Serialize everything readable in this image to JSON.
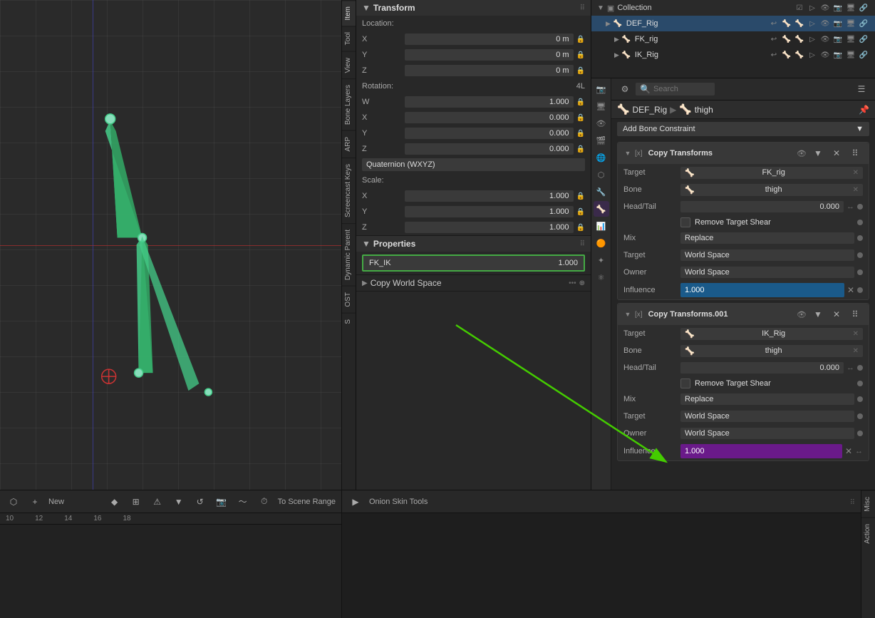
{
  "viewport": {
    "label": "3D Viewport"
  },
  "transform": {
    "title": "Transform",
    "location": {
      "label": "Location:",
      "x": "0 m",
      "y": "0 m",
      "z": "0 m"
    },
    "rotation": {
      "label": "Rotation:",
      "mode_label": "4L",
      "w": "1.000",
      "x": "0.000",
      "y": "0.000",
      "z": "0.000",
      "mode": "Quaternion (WXYZ)"
    },
    "scale": {
      "label": "Scale:",
      "x": "1.000",
      "y": "1.000",
      "z": "1.000"
    }
  },
  "properties": {
    "title": "Properties",
    "fk_ik_label": "FK_IK",
    "fk_ik_value": "1.000",
    "copy_world_label": "Copy World Space"
  },
  "side_tabs": [
    {
      "label": "Item",
      "active": true
    },
    {
      "label": "Tool"
    },
    {
      "label": "View"
    },
    {
      "label": "Bone Layers"
    },
    {
      "label": "ARP"
    },
    {
      "label": "Screencast Keys"
    },
    {
      "label": "Dynamic Parent"
    },
    {
      "label": "OST"
    },
    {
      "label": "S"
    }
  ],
  "outliner": {
    "collection_label": "Collection",
    "items": [
      {
        "name": "DEF_Rig",
        "selected": true,
        "indent": 1
      },
      {
        "name": "FK_rig",
        "selected": false,
        "indent": 2
      },
      {
        "name": "IK_Rig",
        "selected": false,
        "indent": 2
      }
    ]
  },
  "search_placeholder": "Search",
  "bone_nav": {
    "rig_name": "DEF_Rig",
    "bone_name": "thigh"
  },
  "add_constraint": "Add Bone Constraint",
  "constraints": [
    {
      "title": "Copy Transforms",
      "target_label": "Target",
      "target_value": "FK_rig",
      "bone_label": "Bone",
      "bone_value": "thigh",
      "head_tail_label": "Head/Tail",
      "head_tail_value": "0.000",
      "remove_target_shear": "Remove Target Shear",
      "mix_label": "Mix",
      "mix_value": "Replace",
      "target_space_label": "Target",
      "target_space_value": "World Space",
      "owner_space_label": "Owner",
      "owner_space_value": "World Space",
      "influence_label": "Influence",
      "influence_value": "1.000",
      "influence_type": "blue"
    },
    {
      "title": "Copy Transforms.001",
      "target_label": "Target",
      "target_value": "IK_Rig",
      "bone_label": "Bone",
      "bone_value": "thigh",
      "head_tail_label": "Head/Tail",
      "head_tail_value": "0.000",
      "remove_target_shear": "Remove Target Shear",
      "mix_label": "Mix",
      "mix_value": "Replace",
      "target_space_label": "Target",
      "target_space_value": "World Space",
      "owner_space_label": "Owner",
      "owner_space_value": "World Space",
      "influence_label": "Influence",
      "influence_value": "1.000",
      "influence_type": "purple"
    }
  ],
  "timeline": {
    "new_label": "New",
    "to_scene_range": "To Scene Range",
    "onion_skin": "Onion Skin Tools",
    "markers": [
      "10",
      "12",
      "14",
      "16",
      "18"
    ]
  }
}
